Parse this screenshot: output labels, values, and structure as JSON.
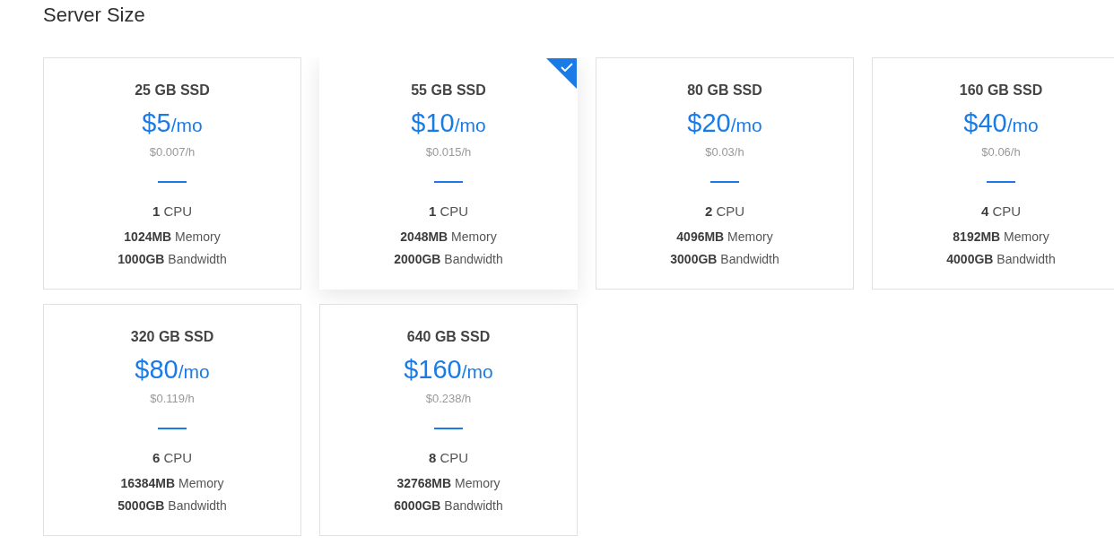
{
  "heading": "Server Size",
  "plans": [
    {
      "storage": "25 GB SSD",
      "price": "$5",
      "period": "/mo",
      "hourly": "$0.007/h",
      "cpu": "**1** CPU",
      "memory": "**1024MB** Memory",
      "bandwidth": "**1000GB** Bandwidth",
      "selected": false
    },
    {
      "storage": "55 GB SSD",
      "price": "$10",
      "period": "/mo",
      "hourly": "$0.015/h",
      "cpu": "**1** CPU",
      "memory": "**2048MB** Memory",
      "bandwidth": "**2000GB** Bandwidth",
      "selected": true
    },
    {
      "storage": "80 GB SSD",
      "price": "$20",
      "period": "/mo",
      "hourly": "$0.03/h",
      "cpu": "**2** CPU",
      "memory": "**4096MB** Memory",
      "bandwidth": "**3000GB** Bandwidth",
      "selected": false
    },
    {
      "storage": "160 GB SSD",
      "price": "$40",
      "period": "/mo",
      "hourly": "$0.06/h",
      "cpu": "**4** CPU",
      "memory": "**8192MB** Memory",
      "bandwidth": "**4000GB** Bandwidth",
      "selected": false
    },
    {
      "storage": "320 GB SSD",
      "price": "$80",
      "period": "/mo",
      "hourly": "$0.119/h",
      "cpu": "**6** CPU",
      "memory": "**16384MB** Memory",
      "bandwidth": "**5000GB** Bandwidth",
      "selected": false
    },
    {
      "storage": "640 GB SSD",
      "price": "$160",
      "period": "/mo",
      "hourly": "$0.238/h",
      "cpu": "**8** CPU",
      "memory": "**32768MB** Memory",
      "bandwidth": "**6000GB** Bandwidth",
      "selected": false
    }
  ]
}
